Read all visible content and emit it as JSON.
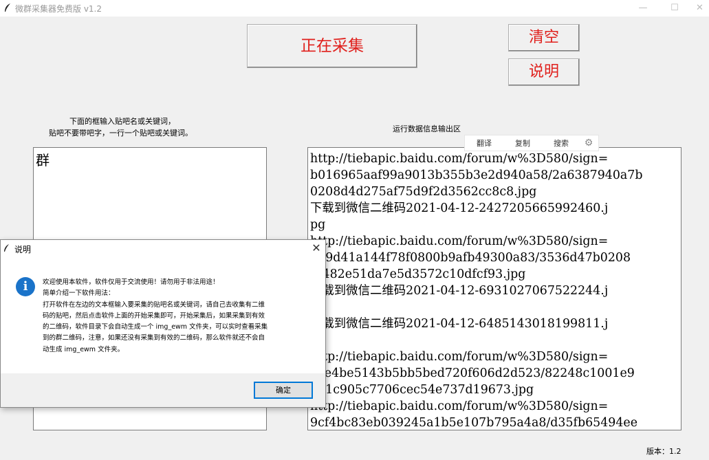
{
  "window": {
    "title": "微群采集器免费版 v1.2",
    "minimize_glyph": "—",
    "maximize_glyph": "☐",
    "close_glyph": "✕"
  },
  "toolbar": {
    "start_button": "正在采集",
    "clear_button": "清空",
    "help_button": "说明"
  },
  "input_panel": {
    "instruction_line1": "下面的框输入贴吧名或关键词，",
    "instruction_line2": "贴吧不要带吧字，一行一个贴吧或关键词。",
    "value": "群"
  },
  "output_panel": {
    "label": "运行数据信息输出区",
    "lines": [
      "http://tiebapic.baidu.com/forum/w%3D580/sign=",
      "b016965aaf99a9013b355b3e2d940a58/2a6387940a7b",
      "0208d4d275af75d9f2d3562cc8c8.jpg",
      "下载到微信二维码2021-04-12-2427205665992460.j",
      "pg",
      "http://tiebapic.baidu.com/forum/w%3D580/sign=",
      "7d9d41a144f78f0800b9afb49300a83/3536d47b0208",
      "6f482e51da7e5d3572c10dfcf93.jpg",
      "下载到微信二维码2021-04-12-6931027067522244.j",
      "",
      "下载到微信二维码2021-04-12-6485143018199811.j",
      "",
      "http://tiebapic.baidu.com/forum/w%3D580/sign=",
      "c0e4be5143b5bb5bed720f606d2d523/82248c1001e9",
      "301c905c7706cec54e737d19673.jpg",
      "http://tiebapic.baidu.com/forum/w%3D580/sign=",
      "9cf4bc83eb039245a1b5e107b795a4a8/d35fb65494ee"
    ]
  },
  "floating_toolbar": {
    "translate": "翻译",
    "copy": "复制",
    "search": "搜索",
    "settings_icon": "gear-icon"
  },
  "dialog": {
    "title": "说明",
    "close_glyph": "✕",
    "info_icon_glyph": "i",
    "message_lines": [
      "欢迎使用本软件，软件仅用于交流使用！请勿用于非法用途！",
      "简单介绍一下软件用法：",
      "打开软件在左边的文本框输入要采集的贴吧名或关键词，请自己去收集有二维",
      "码的贴吧，然后点击软件上面的开始采集即可，开始采集后，如果采集到有效",
      "的二维码，软件目录下会自动生成一个 img_ewm 文件夹，可以实时查看采集",
      "到的群二维码，注意，如果还没有采集到有效的二维码，那么软件就还不会自",
      "动生成 img_ewm 文件夹。"
    ],
    "ok_button": "确定"
  },
  "status": {
    "version": "版本：1.2"
  },
  "colors": {
    "button_text": "#e0201c",
    "info_icon": "#1a73c9",
    "focus_border": "#0078d7"
  }
}
